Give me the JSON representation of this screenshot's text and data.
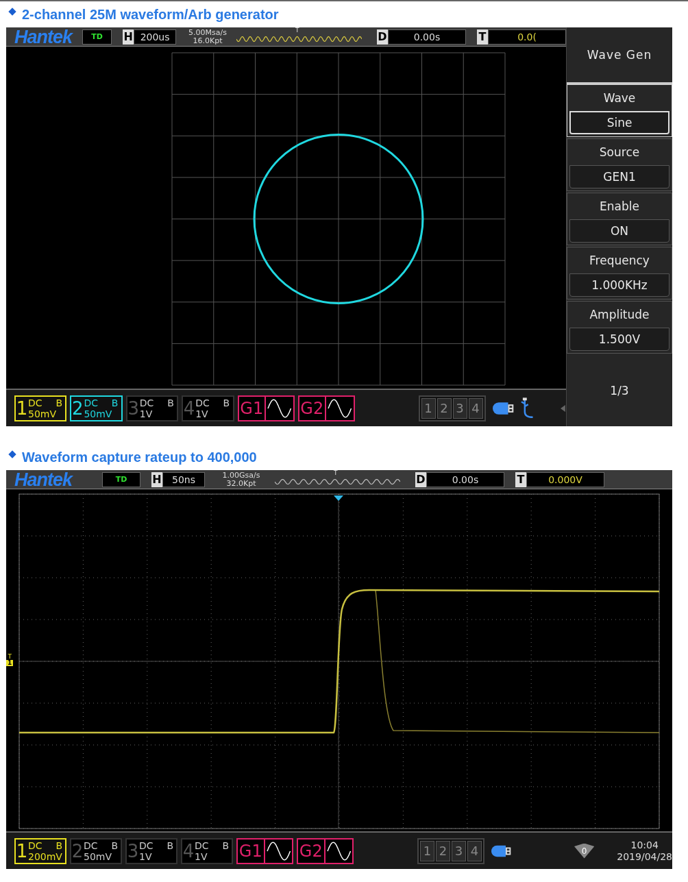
{
  "sections": [
    {
      "heading": "2-channel 25M waveform/Arb generator",
      "screen": {
        "kind": "xy",
        "brand": "Hantek",
        "mode": "TD",
        "horizontal": {
          "label": "H",
          "value": "200us"
        },
        "sample_rate": "5.00Msa/s",
        "memory": "16.0Kpt",
        "trigger_marker": "T",
        "delay": {
          "label": "D",
          "value": "0.00s"
        },
        "trigger": {
          "label": "T",
          "value": "0.0("
        },
        "channels": [
          {
            "number": "1",
            "coupling": "DC",
            "bandwidth": "B",
            "scale": "50mV",
            "on": true,
            "color": "#e8e020"
          },
          {
            "number": "2",
            "coupling": "DC",
            "bandwidth": "B",
            "scale": "50mV",
            "on": true,
            "color": "#20d8e0"
          },
          {
            "number": "3",
            "coupling": "DC",
            "bandwidth": "B",
            "scale": "1V",
            "on": false
          },
          {
            "number": "4",
            "coupling": "DC",
            "bandwidth": "B",
            "scale": "1V",
            "on": false
          }
        ],
        "generators": [
          {
            "label": "G1"
          },
          {
            "label": "G2"
          }
        ],
        "channel_keys": [
          "1",
          "2",
          "3",
          "4"
        ],
        "status": {
          "kind": "usb"
        },
        "menu": {
          "title": "Wave Gen",
          "items": [
            {
              "label": "Wave",
              "value": "Sine",
              "selected": true
            },
            {
              "label": "Source",
              "value": "GEN1",
              "selected": false
            },
            {
              "label": "Enable",
              "value": "ON",
              "selected": false
            },
            {
              "label": "Frequency",
              "value": "1.000KHz",
              "selected": false
            },
            {
              "label": "Amplitude",
              "value": "1.500V",
              "selected": false
            }
          ],
          "page": "1/3"
        }
      }
    },
    {
      "heading": "Waveform capture rateup to 400,000",
      "screen": {
        "kind": "yt",
        "brand": "Hantek",
        "mode": "TD",
        "horizontal": {
          "label": "H",
          "value": "50ns"
        },
        "sample_rate": "1.00Gsa/s",
        "memory": "32.0Kpt",
        "trigger_marker": "T",
        "delay": {
          "label": "D",
          "value": "0.00s"
        },
        "trigger": {
          "label": "T",
          "value": "0.000V"
        },
        "level_marker": {
          "label": "T",
          "channel": "1"
        },
        "channels": [
          {
            "number": "1",
            "coupling": "DC",
            "bandwidth": "B",
            "scale": "200mV",
            "on": true,
            "color": "#e8e020"
          },
          {
            "number": "2",
            "coupling": "DC",
            "bandwidth": "B",
            "scale": "50mV",
            "on": false
          },
          {
            "number": "3",
            "coupling": "DC",
            "bandwidth": "B",
            "scale": "1V",
            "on": false
          },
          {
            "number": "4",
            "coupling": "DC",
            "bandwidth": "B",
            "scale": "1V",
            "on": false
          }
        ],
        "generators": [
          {
            "label": "G1"
          },
          {
            "label": "G2"
          }
        ],
        "channel_keys": [
          "1",
          "2",
          "3",
          "4"
        ],
        "status": {
          "kind": "clock",
          "badge": "0",
          "time": "10:04",
          "date": "2019/04/28"
        }
      }
    }
  ]
}
